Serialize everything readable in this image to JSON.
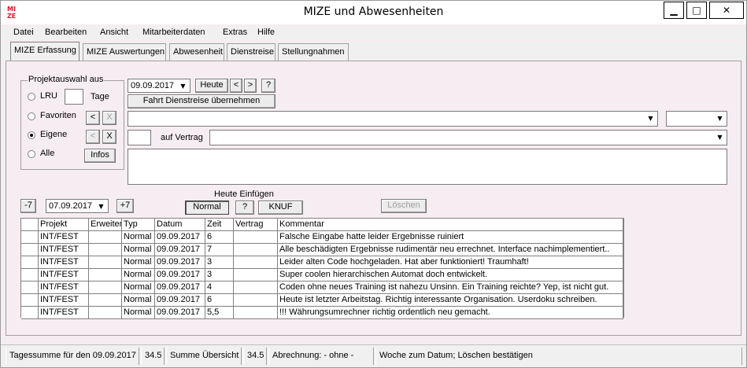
{
  "window": {
    "title": "MIZE und Abwesenheiten",
    "logo_text_top": "MI",
    "logo_text_bottom": "ZE",
    "controls": {
      "minimize": "▁",
      "maximize": "□",
      "close": "✕"
    }
  },
  "menu": [
    {
      "label": "Datei"
    },
    {
      "label": "Bearbeiten"
    },
    {
      "label": "Ansicht"
    },
    {
      "label": "Mitarbeiterdaten"
    },
    {
      "label": "Extras"
    },
    {
      "label": "Hilfe"
    }
  ],
  "tabs": [
    {
      "label": "MIZE Erfassung",
      "active": true
    },
    {
      "label": "MIZE Auswertungen",
      "active": false
    },
    {
      "label": "Abwesenheit",
      "active": false
    },
    {
      "label": "Dienstreise",
      "active": false
    },
    {
      "label": "Stellungnahmen",
      "active": false
    }
  ],
  "project_selection": {
    "title": "Projektauswahl aus",
    "options": [
      {
        "label": "LRU",
        "checked": false
      },
      {
        "label": "Favoriten",
        "checked": false
      },
      {
        "label": "Eigene",
        "checked": true
      },
      {
        "label": "Alle",
        "checked": false
      }
    ],
    "days_value": "",
    "days_label": "Tage",
    "fav_left": "<",
    "fav_remove": "X",
    "own_left": "<",
    "own_remove": "X",
    "infos_button": "Infos"
  },
  "date_controls": {
    "date_value": "09.09.2017",
    "today_button": "Heute",
    "prev_button": "<",
    "next_button": ">",
    "help_button": "?",
    "trip_button": "Fahrt Dienstreise übernehmen",
    "project_dropdown": "",
    "secondary_dropdown": "",
    "time_value": "",
    "contract_label": "auf Vertrag",
    "contract_dropdown": "",
    "comment_value": ""
  },
  "entry_controls": {
    "minus7": "-7",
    "plus7": "+7",
    "range_date": "07.09.2017",
    "insert_title": "Heute Einfügen",
    "normal_button": "Normal",
    "help_button": "?",
    "knuf_button": "KNUF",
    "delete_button": "Löschen"
  },
  "table": {
    "headers": [
      "Projekt",
      "Erweiterun",
      "Typ",
      "Datum",
      "Zeit",
      "Vertrag",
      "Kommentar"
    ],
    "rows": [
      [
        "INT/FEST",
        "",
        "Normal",
        "09.09.2017",
        "6",
        "",
        "Falsche Eingabe hatte leider Ergebnisse ruiniert"
      ],
      [
        "INT/FEST",
        "",
        "Normal",
        "09.09.2017",
        "7",
        "",
        "Alle beschädigten Ergebnisse rudimentär neu errechnet. Interface nachimplementiert.."
      ],
      [
        "INT/FEST",
        "",
        "Normal",
        "09.09.2017",
        "3",
        "",
        "Leider alten Code hochgeladen. Hat aber funktioniert! Traumhaft!"
      ],
      [
        "INT/FEST",
        "",
        "Normal",
        "09.09.2017",
        "3",
        "",
        "Super coolen hierarchischen Automat doch entwickelt."
      ],
      [
        "INT/FEST",
        "",
        "Normal",
        "09.09.2017",
        "4",
        "",
        "Coden ohne neues Training ist nahezu Unsinn. Ein Training reichte? Yep, ist nicht gut."
      ],
      [
        "INT/FEST",
        "",
        "Normal",
        "09.09.2017",
        "6",
        "",
        "Heute ist letzter Arbeitstag. Richtig interessante Organisation. Userdoku schreiben."
      ],
      [
        "INT/FEST",
        "",
        "Normal",
        "09.09.2017",
        "5,5",
        "",
        "!!! Währungsumrechner richtig ordentlich neu gemacht."
      ]
    ]
  },
  "status": {
    "daily_sum_label": "Tagessumme für den 09.09.2017",
    "daily_sum_value": "34.5",
    "summary_label": "Summe Übersicht",
    "summary_value": "34.5",
    "billing": "Abrechnung: - ohne -",
    "message": "Woche zum Datum; Löschen bestätigen"
  }
}
